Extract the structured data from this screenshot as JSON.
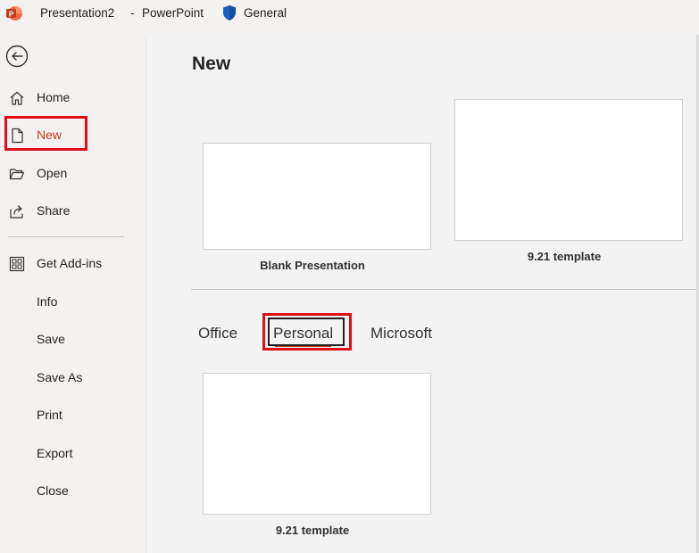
{
  "titlebar": {
    "doc_name": "Presentation2",
    "separator": "-",
    "app_name": "PowerPoint",
    "sensitivity_label": "General"
  },
  "sidebar": {
    "items": [
      {
        "label": "Home",
        "icon": "home-icon"
      },
      {
        "label": "New",
        "icon": "new-document-icon",
        "active": true
      },
      {
        "label": "Open",
        "icon": "open-folder-icon"
      },
      {
        "label": "Share",
        "icon": "share-icon"
      },
      {
        "label": "Get Add-ins",
        "icon": "add-ins-grid-icon"
      },
      {
        "label": "Info"
      },
      {
        "label": "Save"
      },
      {
        "label": "Save As"
      },
      {
        "label": "Print"
      },
      {
        "label": "Export"
      },
      {
        "label": "Close"
      }
    ]
  },
  "main": {
    "title": "New",
    "featured": [
      {
        "label": "Blank Presentation"
      },
      {
        "label": "9.21 template"
      }
    ],
    "tabs": [
      {
        "label": "Office"
      },
      {
        "label": "Personal",
        "selected": true
      },
      {
        "label": "Microsoft"
      }
    ],
    "personal_templates": [
      {
        "label": "9.21 template"
      }
    ]
  },
  "colors": {
    "accent": "#c43e1c",
    "highlight_box": "#e0101a",
    "background": "#f3f2f1"
  }
}
